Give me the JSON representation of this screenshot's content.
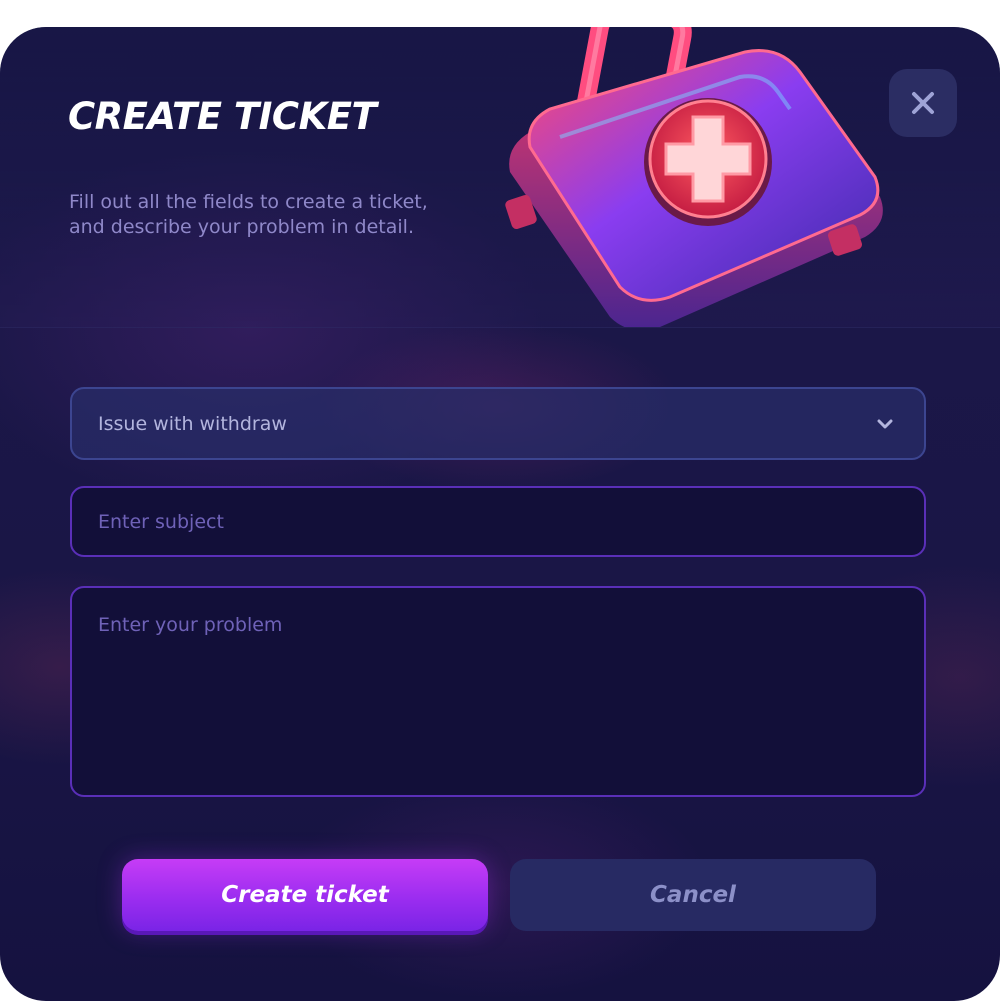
{
  "modal": {
    "title": "CREATE TICKET",
    "subtitle": "Fill out all the fields to create a ticket, and describe your problem in detail.",
    "close_icon": "close-icon",
    "illustration": "first-aid-kit"
  },
  "form": {
    "category": {
      "selected": "Issue with withdraw",
      "icon": "chevron-down-icon"
    },
    "subject": {
      "value": "",
      "placeholder": "Enter subject"
    },
    "problem": {
      "value": "",
      "placeholder": "Enter your problem"
    }
  },
  "actions": {
    "create_label": "Create ticket",
    "cancel_label": "Cancel"
  },
  "colors": {
    "background": "#1a1646",
    "primary": "#a030f0",
    "secondary_button": "#272a63",
    "input_border": "#5a2fb8",
    "select_border": "#3c4590"
  }
}
